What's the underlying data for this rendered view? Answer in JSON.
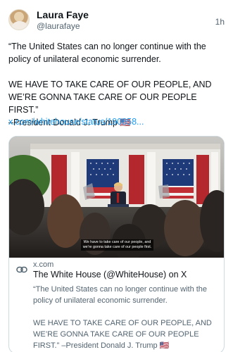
{
  "author": {
    "name": "Laura Faye",
    "handle": "@laurafaye",
    "time": "1h"
  },
  "post": {
    "paragraph1": "“The United States can no longer continue with the policy of unilateral economic surrender.",
    "paragraph2": "WE HAVE TO TAKE CARE OF OUR PEOPLE, AND WE’RE GONNA TAKE CARE OF OUR PEOPLE FIRST.”",
    "attribution": "–President Donald J. Trump 🇺🇸",
    "link": "x.com/whitehouse/status/190858..."
  },
  "card": {
    "caption": "We have to take care of our people, and\nwe're gonna take care of our people first.",
    "domain": "x.com",
    "title": "The White House (@WhiteHouse) on X",
    "desc1": "“The United States can no longer continue with the policy of unilateral economic surrender.",
    "desc2": "WE HAVE TO TAKE CARE OF OUR PEOPLE, AND WE’RE GONNA TAKE CARE OF OUR PEOPLE FIRST.” –President Donald J. Trump 🇺🇸",
    "link_icon": "link-icon"
  },
  "colors": {
    "text": "#0f1419",
    "secondary": "#536471",
    "link": "#1d9bf0",
    "border": "#cfd9de"
  }
}
